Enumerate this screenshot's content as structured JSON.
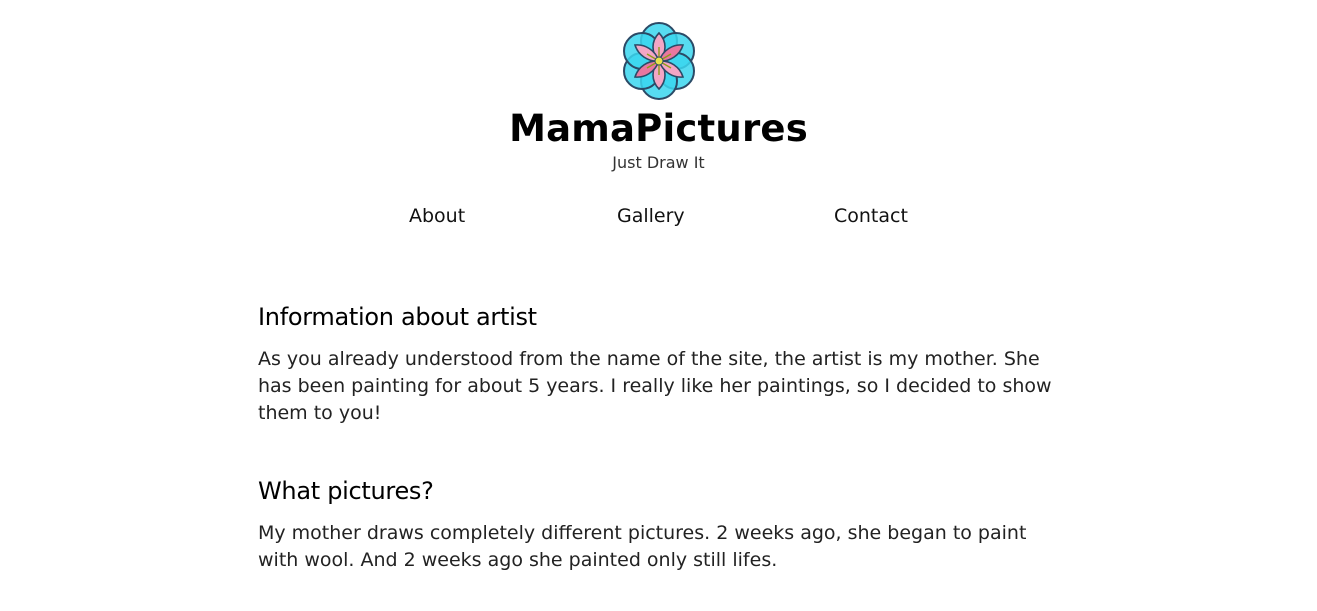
{
  "header": {
    "logo_icon": "flower-of-life-logo-icon",
    "title": "MamaPictures",
    "tagline": "Just Draw It"
  },
  "nav": {
    "items": [
      {
        "label": "About"
      },
      {
        "label": "Gallery"
      },
      {
        "label": "Contact"
      }
    ]
  },
  "main": {
    "sections": [
      {
        "heading": "Information about artist",
        "body": "As you already understood from the name of the site, the artist is my mother. She has been painting for about 5 years. I really like her paintings, so I decided to show them to you!"
      },
      {
        "heading": "What pictures?",
        "body": "My mother draws completely different pictures. 2 weeks ago, she began to paint with wool. And 2 weeks ago she painted only still lifes."
      }
    ]
  },
  "colors": {
    "logo_outer": "#3ad6ef",
    "logo_petal": "#f3a6c5",
    "logo_petal_dark": "#e9779f",
    "logo_center": "#e8e24a",
    "logo_stroke": "#2b4a66"
  }
}
